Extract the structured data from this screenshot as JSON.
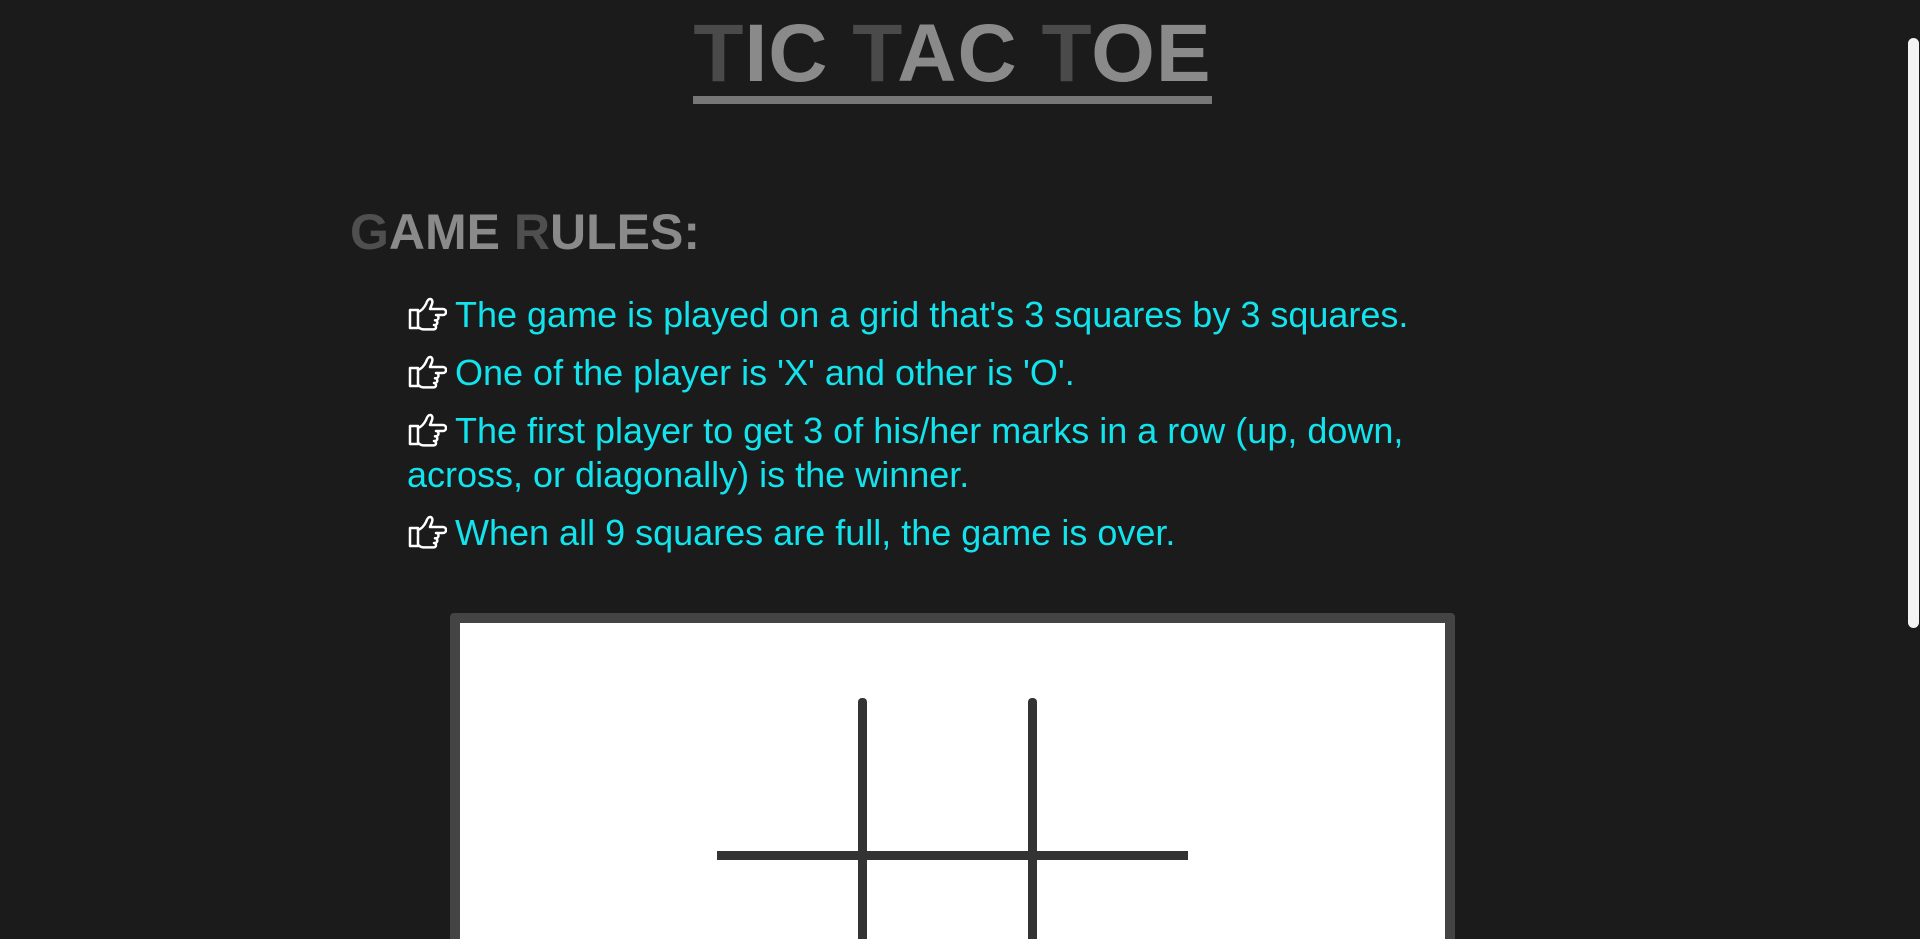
{
  "title": {
    "words": [
      {
        "cap": "T",
        "rest": "IC"
      },
      {
        "cap": "T",
        "rest": "AC"
      },
      {
        "cap": "T",
        "rest": "OE"
      }
    ]
  },
  "rules": {
    "heading": [
      {
        "cap": "G",
        "rest": "AME"
      },
      {
        "cap": "R",
        "rest": "ULES:"
      }
    ],
    "icon": "hand-pointing-right-icon",
    "items": [
      "The game is played on a grid that's 3 squares by 3 squares.",
      "One of the player is 'X' and other is 'O'.",
      "The first player to get 3 of his/her marks in a row (up, down, across, or diagonally) is the winner.",
      "When all 9 squares are full, the game is over."
    ]
  },
  "colors": {
    "background": "#1b1b1b",
    "rule_text": "#12e3ec",
    "title_text": "#8a8a8a",
    "board_border": "#444444",
    "grid_line": "#333333"
  }
}
